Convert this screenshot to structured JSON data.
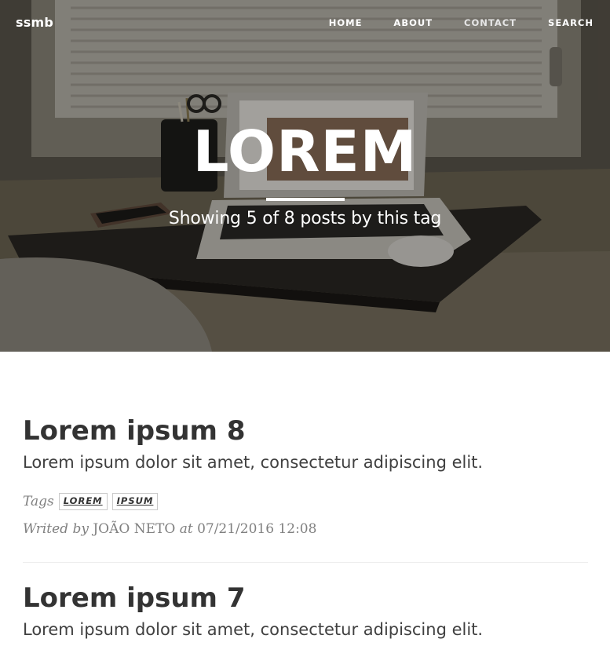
{
  "nav": {
    "brand": "ssmb",
    "links": [
      {
        "label": "HOME"
      },
      {
        "label": "ABOUT"
      },
      {
        "label": "CONTACT"
      },
      {
        "label": "SEARCH"
      }
    ]
  },
  "hero": {
    "title": "LOREM",
    "subtitle": "Showing 5 of 8 posts by this tag"
  },
  "posts": [
    {
      "title": "Lorem ipsum 8",
      "excerpt": "Lorem ipsum dolor sit amet, consectetur adipiscing elit.",
      "tags_label": "Tags",
      "tags": [
        "LOREM",
        "IPSUM"
      ],
      "written_by": "Writed by",
      "author": "JOÃO NETO",
      "at": "at",
      "date": "07/21/2016 12:08"
    },
    {
      "title": "Lorem ipsum 7",
      "excerpt": "Lorem ipsum dolor sit amet, consectetur adipiscing elit."
    }
  ],
  "colors": {
    "text": "#333333",
    "meta": "#808080",
    "hero_text": "#ffffff",
    "separator": "#eeeeee"
  }
}
